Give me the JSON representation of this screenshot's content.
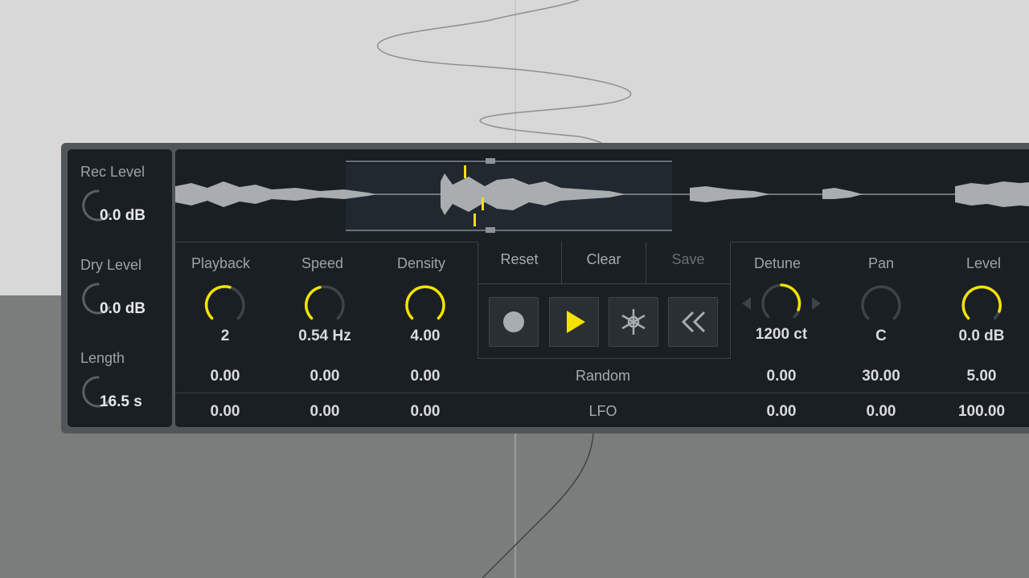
{
  "left": {
    "rec_level": {
      "label": "Rec Level",
      "value": "0.0 dB",
      "level": 0.15
    },
    "dry_level": {
      "label": "Dry Level",
      "value": "0.0 dB",
      "level": 0.15
    },
    "length": {
      "label": "Length",
      "value": "16.5 s",
      "level": 0.3
    }
  },
  "knobs": [
    {
      "label": "Playback",
      "value": "2",
      "level": 0.55,
      "random": "0.00",
      "lfo": "0.00"
    },
    {
      "label": "Speed",
      "value": "0.54 Hz",
      "level": 0.45,
      "random": "0.00",
      "lfo": "0.00"
    },
    {
      "label": "Density",
      "value": "4.00",
      "level": 1.0,
      "random": "0.00",
      "lfo": "0.00"
    }
  ],
  "actions": {
    "reset": "Reset",
    "clear": "Clear",
    "save": "Save"
  },
  "transport": {
    "record": "record-icon",
    "play": "play-icon",
    "freeze": "snowflake-icon",
    "rewind": "rewind-icon"
  },
  "rows": {
    "random": "Random",
    "lfo": "LFO"
  },
  "right_knobs": [
    {
      "label": "Detune",
      "value": "1200 ct",
      "level": 0.65,
      "random": "0.00",
      "lfo": "0.00"
    },
    {
      "label": "Pan",
      "value": "C",
      "level": 0.5,
      "random": "30.00",
      "lfo": "0.00"
    },
    {
      "label": "Level",
      "value": "0.0 dB",
      "level": 0.85,
      "random": "5.00",
      "lfo": "100.00"
    }
  ],
  "colors": {
    "accent": "#f4e200",
    "panel": "#1a1f24",
    "text": "#e6e7e8",
    "label": "#9ea3a6"
  }
}
